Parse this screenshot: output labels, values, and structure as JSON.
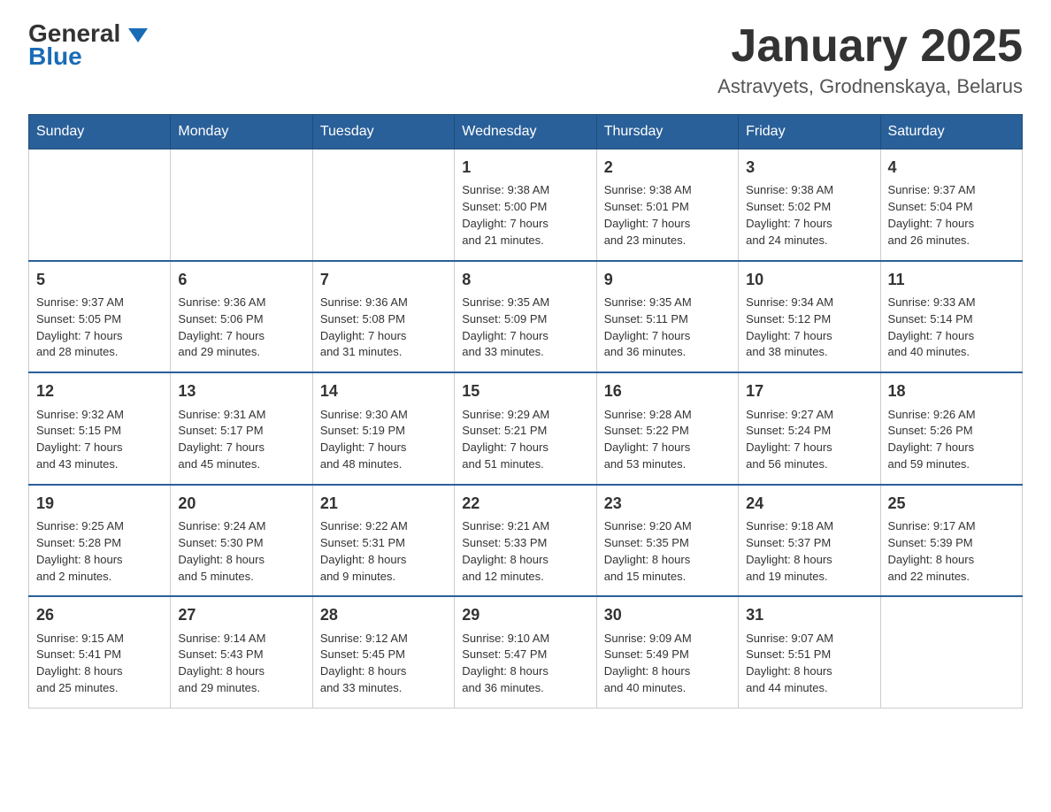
{
  "header": {
    "logo_text_black": "General",
    "logo_text_blue": "Blue",
    "month_title": "January 2025",
    "location": "Astravyets, Grodnenskaya, Belarus"
  },
  "days_of_week": [
    "Sunday",
    "Monday",
    "Tuesday",
    "Wednesday",
    "Thursday",
    "Friday",
    "Saturday"
  ],
  "weeks": [
    [
      {
        "day": "",
        "info": ""
      },
      {
        "day": "",
        "info": ""
      },
      {
        "day": "",
        "info": ""
      },
      {
        "day": "1",
        "info": "Sunrise: 9:38 AM\nSunset: 5:00 PM\nDaylight: 7 hours\nand 21 minutes."
      },
      {
        "day": "2",
        "info": "Sunrise: 9:38 AM\nSunset: 5:01 PM\nDaylight: 7 hours\nand 23 minutes."
      },
      {
        "day": "3",
        "info": "Sunrise: 9:38 AM\nSunset: 5:02 PM\nDaylight: 7 hours\nand 24 minutes."
      },
      {
        "day": "4",
        "info": "Sunrise: 9:37 AM\nSunset: 5:04 PM\nDaylight: 7 hours\nand 26 minutes."
      }
    ],
    [
      {
        "day": "5",
        "info": "Sunrise: 9:37 AM\nSunset: 5:05 PM\nDaylight: 7 hours\nand 28 minutes."
      },
      {
        "day": "6",
        "info": "Sunrise: 9:36 AM\nSunset: 5:06 PM\nDaylight: 7 hours\nand 29 minutes."
      },
      {
        "day": "7",
        "info": "Sunrise: 9:36 AM\nSunset: 5:08 PM\nDaylight: 7 hours\nand 31 minutes."
      },
      {
        "day": "8",
        "info": "Sunrise: 9:35 AM\nSunset: 5:09 PM\nDaylight: 7 hours\nand 33 minutes."
      },
      {
        "day": "9",
        "info": "Sunrise: 9:35 AM\nSunset: 5:11 PM\nDaylight: 7 hours\nand 36 minutes."
      },
      {
        "day": "10",
        "info": "Sunrise: 9:34 AM\nSunset: 5:12 PM\nDaylight: 7 hours\nand 38 minutes."
      },
      {
        "day": "11",
        "info": "Sunrise: 9:33 AM\nSunset: 5:14 PM\nDaylight: 7 hours\nand 40 minutes."
      }
    ],
    [
      {
        "day": "12",
        "info": "Sunrise: 9:32 AM\nSunset: 5:15 PM\nDaylight: 7 hours\nand 43 minutes."
      },
      {
        "day": "13",
        "info": "Sunrise: 9:31 AM\nSunset: 5:17 PM\nDaylight: 7 hours\nand 45 minutes."
      },
      {
        "day": "14",
        "info": "Sunrise: 9:30 AM\nSunset: 5:19 PM\nDaylight: 7 hours\nand 48 minutes."
      },
      {
        "day": "15",
        "info": "Sunrise: 9:29 AM\nSunset: 5:21 PM\nDaylight: 7 hours\nand 51 minutes."
      },
      {
        "day": "16",
        "info": "Sunrise: 9:28 AM\nSunset: 5:22 PM\nDaylight: 7 hours\nand 53 minutes."
      },
      {
        "day": "17",
        "info": "Sunrise: 9:27 AM\nSunset: 5:24 PM\nDaylight: 7 hours\nand 56 minutes."
      },
      {
        "day": "18",
        "info": "Sunrise: 9:26 AM\nSunset: 5:26 PM\nDaylight: 7 hours\nand 59 minutes."
      }
    ],
    [
      {
        "day": "19",
        "info": "Sunrise: 9:25 AM\nSunset: 5:28 PM\nDaylight: 8 hours\nand 2 minutes."
      },
      {
        "day": "20",
        "info": "Sunrise: 9:24 AM\nSunset: 5:30 PM\nDaylight: 8 hours\nand 5 minutes."
      },
      {
        "day": "21",
        "info": "Sunrise: 9:22 AM\nSunset: 5:31 PM\nDaylight: 8 hours\nand 9 minutes."
      },
      {
        "day": "22",
        "info": "Sunrise: 9:21 AM\nSunset: 5:33 PM\nDaylight: 8 hours\nand 12 minutes."
      },
      {
        "day": "23",
        "info": "Sunrise: 9:20 AM\nSunset: 5:35 PM\nDaylight: 8 hours\nand 15 minutes."
      },
      {
        "day": "24",
        "info": "Sunrise: 9:18 AM\nSunset: 5:37 PM\nDaylight: 8 hours\nand 19 minutes."
      },
      {
        "day": "25",
        "info": "Sunrise: 9:17 AM\nSunset: 5:39 PM\nDaylight: 8 hours\nand 22 minutes."
      }
    ],
    [
      {
        "day": "26",
        "info": "Sunrise: 9:15 AM\nSunset: 5:41 PM\nDaylight: 8 hours\nand 25 minutes."
      },
      {
        "day": "27",
        "info": "Sunrise: 9:14 AM\nSunset: 5:43 PM\nDaylight: 8 hours\nand 29 minutes."
      },
      {
        "day": "28",
        "info": "Sunrise: 9:12 AM\nSunset: 5:45 PM\nDaylight: 8 hours\nand 33 minutes."
      },
      {
        "day": "29",
        "info": "Sunrise: 9:10 AM\nSunset: 5:47 PM\nDaylight: 8 hours\nand 36 minutes."
      },
      {
        "day": "30",
        "info": "Sunrise: 9:09 AM\nSunset: 5:49 PM\nDaylight: 8 hours\nand 40 minutes."
      },
      {
        "day": "31",
        "info": "Sunrise: 9:07 AM\nSunset: 5:51 PM\nDaylight: 8 hours\nand 44 minutes."
      },
      {
        "day": "",
        "info": ""
      }
    ]
  ]
}
